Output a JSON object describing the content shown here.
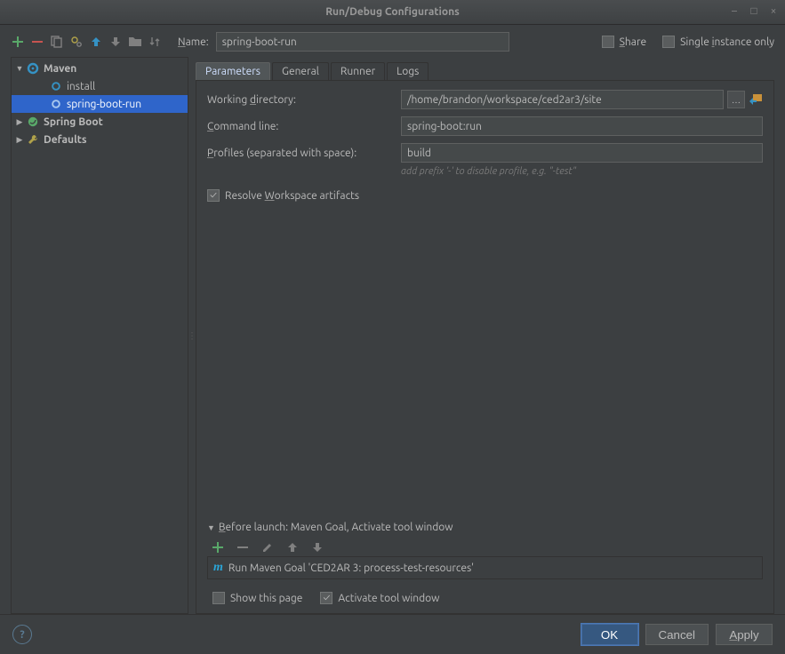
{
  "window": {
    "title": "Run/Debug Configurations"
  },
  "name_label": "Name:",
  "name_value": "spring-boot-run",
  "share_label": "Share",
  "single_instance_label": "Single instance only",
  "tree": {
    "maven": "Maven",
    "install": "install",
    "sbr": "spring-boot-run",
    "springboot": "Spring Boot",
    "defaults": "Defaults"
  },
  "tabs": {
    "parameters": "Parameters",
    "general": "General",
    "runner": "Runner",
    "logs": "Logs"
  },
  "form": {
    "wd_label": "Working directory:",
    "wd_value": "/home/brandon/workspace/ced2ar3/site",
    "cmd_label": "Command line:",
    "cmd_value": "spring-boot:run",
    "profiles_label": "Profiles (separated with space):",
    "profiles_value": "build",
    "profiles_hint": "add prefix '-' to disable profile, e.g. \"-test\"",
    "resolve_label": "Resolve Workspace artifacts"
  },
  "before": {
    "header": "Before launch: Maven Goal, Activate tool window",
    "item": "Run Maven Goal 'CED2AR 3: process-test-resources'",
    "show_page": "Show this page",
    "activate_tw": "Activate tool window"
  },
  "buttons": {
    "ok": "OK",
    "cancel": "Cancel",
    "apply": "Apply"
  }
}
